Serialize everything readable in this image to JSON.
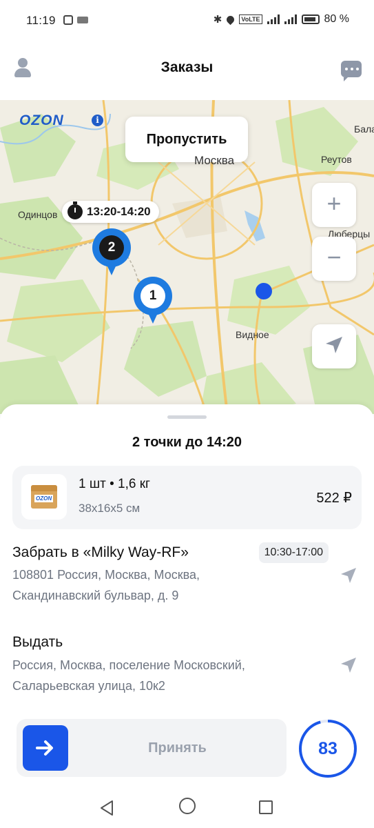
{
  "status_bar": {
    "time": "11:19",
    "battery": "80 %",
    "volte": "VoLTE"
  },
  "header": {
    "title": "Заказы"
  },
  "map": {
    "logo": "OZON",
    "skip_label": "Пропустить",
    "labels": {
      "moscow": "Москва",
      "reutov": "Реутов",
      "balashikha": "Бала",
      "odintsovo": "Одинцов",
      "lyubertsy": "Люберцы",
      "vidnoe": "Видное"
    },
    "time_window": "13:20-14:20",
    "pins": [
      {
        "number": "2"
      },
      {
        "number": "1"
      }
    ],
    "zoom_in": "+",
    "zoom_out": "−"
  },
  "sheet": {
    "title": "2 точки до 14:20",
    "item": {
      "quantity_weight": "1 шт • 1,6 кг",
      "dimensions": "38x16x5 см",
      "price": "522 ₽",
      "box_brand": "OZON"
    },
    "pickup": {
      "title": "Забрать в «Milky Way-RF»",
      "time": "10:30-17:00",
      "address_line1": "108801 Россия, Москва, Москва,",
      "address_line2": "Скандинавский бульвар, д. 9"
    },
    "delivery": {
      "title": "Выдать",
      "address_line1": "Россия, Москва, поселение Московский,",
      "address_line2": "Саларьевская улица, 10к2"
    },
    "accept_label": "Принять",
    "countdown": "83"
  },
  "colors": {
    "accent": "#1a56e8",
    "pin": "#1e7be0",
    "ozon": "#1f5cc8"
  }
}
